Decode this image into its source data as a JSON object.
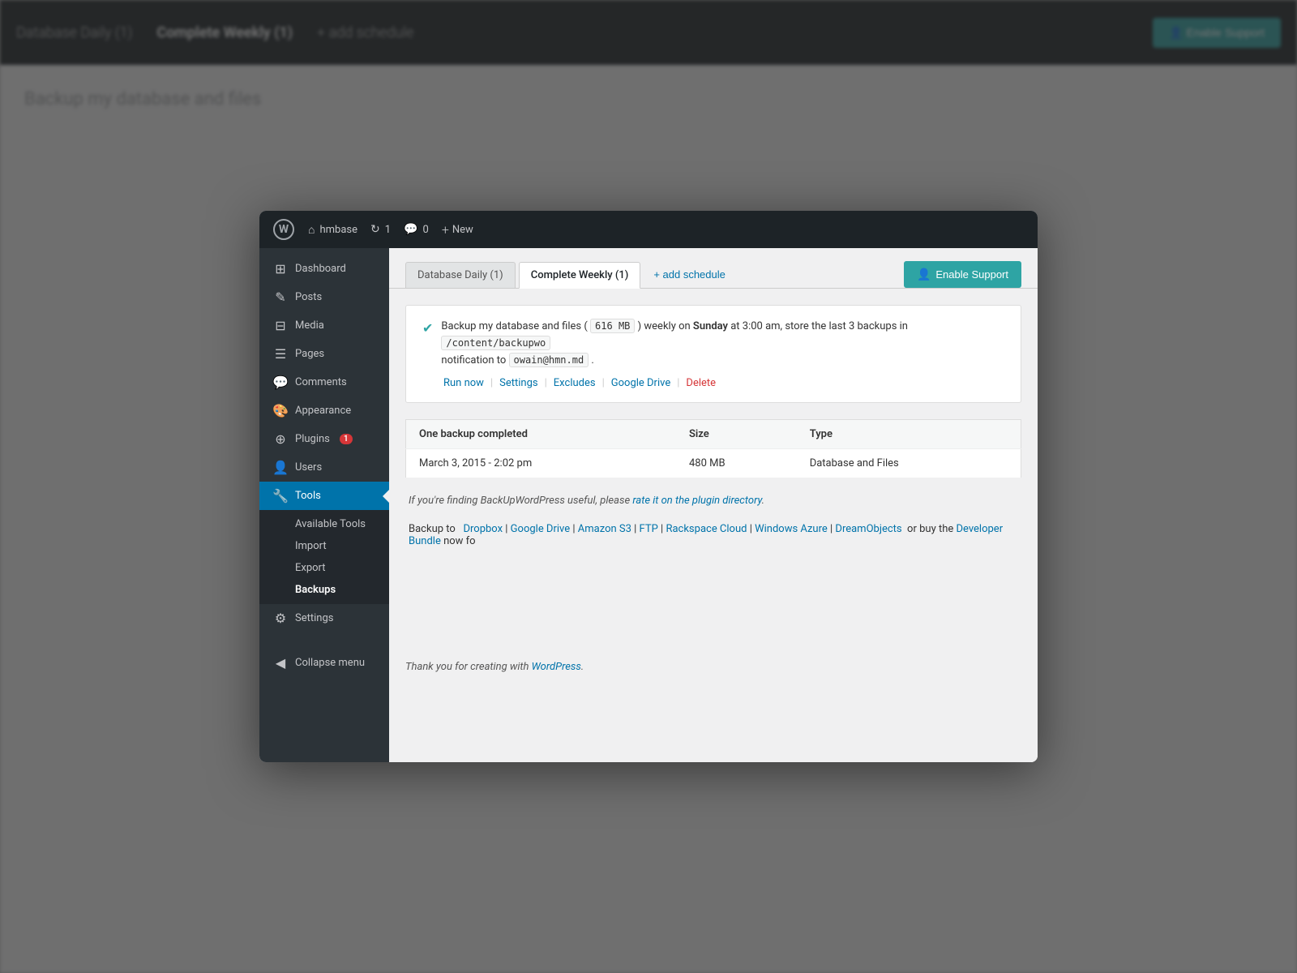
{
  "background": {
    "topbar": {
      "tab1": "Database Daily (1)",
      "tab2": "Complete Weekly (1)",
      "add_schedule": "+ add schedule",
      "enable_btn": "Enable Support"
    },
    "page": {
      "heading": "Backup my database and files"
    }
  },
  "adminbar": {
    "site_name": "hmbase",
    "updates": "1",
    "comments": "0",
    "new_label": "New",
    "wp_icon": "W"
  },
  "sidebar": {
    "items": [
      {
        "id": "dashboard",
        "label": "Dashboard",
        "icon": "⊞"
      },
      {
        "id": "posts",
        "label": "Posts",
        "icon": "✎"
      },
      {
        "id": "media",
        "label": "Media",
        "icon": "⊟"
      },
      {
        "id": "pages",
        "label": "Pages",
        "icon": "☰"
      },
      {
        "id": "comments",
        "label": "Comments",
        "icon": "💬"
      },
      {
        "id": "appearance",
        "label": "Appearance",
        "icon": "🎨"
      },
      {
        "id": "plugins",
        "label": "Plugins",
        "icon": "⊕",
        "badge": "1"
      },
      {
        "id": "users",
        "label": "Users",
        "icon": "👤"
      },
      {
        "id": "tools",
        "label": "Tools",
        "icon": "🔧",
        "active": true
      }
    ],
    "tools_submenu": [
      {
        "id": "available-tools",
        "label": "Available Tools"
      },
      {
        "id": "import",
        "label": "Import"
      },
      {
        "id": "export",
        "label": "Export"
      },
      {
        "id": "backups",
        "label": "Backups",
        "active": true
      }
    ],
    "settings": {
      "label": "Settings",
      "icon": "⚙"
    },
    "collapse": {
      "label": "Collapse menu",
      "icon": "◀"
    }
  },
  "content": {
    "tabs": [
      {
        "id": "database-daily",
        "label": "Database Daily (1)",
        "active": false
      },
      {
        "id": "complete-weekly",
        "label": "Complete Weekly (1)",
        "active": true
      }
    ],
    "add_schedule": "+ add schedule",
    "enable_support": "Enable Support",
    "backup_description": {
      "checkmark": "✔",
      "text_before": "Backup my database and files (",
      "size": "616 MB",
      "text_middle": ") weekly on",
      "day": "Sunday",
      "text_after": "at 3:00 am, store the last 3 backups in",
      "path": "/content/backupwor",
      "text_notify": "notification to",
      "email": "owain@hmn.md",
      "period": "."
    },
    "backup_actions": [
      {
        "id": "run-now",
        "label": "Run now",
        "type": "link"
      },
      {
        "id": "settings",
        "label": "Settings",
        "type": "link"
      },
      {
        "id": "excludes",
        "label": "Excludes",
        "type": "link"
      },
      {
        "id": "google-drive",
        "label": "Google Drive",
        "type": "link"
      },
      {
        "id": "delete",
        "label": "Delete",
        "type": "delete"
      }
    ],
    "table": {
      "headers": [
        "One backup completed",
        "Size",
        "Type"
      ],
      "rows": [
        {
          "date": "March 3, 2015 - 2:02 pm",
          "size": "480  MB",
          "type": "Database and Files"
        }
      ]
    },
    "rate_text": {
      "before": "If you're finding BackUpWordPress useful, please",
      "link_text": "rate it on the plugin directory",
      "after": "."
    },
    "destinations": {
      "label": "Backup to",
      "links": [
        {
          "id": "dropbox",
          "label": "Dropbox"
        },
        {
          "id": "google-drive",
          "label": "Google Drive"
        },
        {
          "id": "amazon-s3",
          "label": "Amazon S3"
        },
        {
          "id": "ftp",
          "label": "FTP"
        },
        {
          "id": "rackspace-cloud",
          "label": "Rackspace Cloud"
        },
        {
          "id": "windows-azure",
          "label": "Windows Azure"
        },
        {
          "id": "dreamobjects",
          "label": "DreamObjects"
        }
      ],
      "or_buy": "or buy the",
      "bundle_link": "Developer Bundle",
      "bundle_after": "now for"
    },
    "thank_you": {
      "before": "Thank you for creating with",
      "link": "WordPress",
      "after": "."
    }
  }
}
